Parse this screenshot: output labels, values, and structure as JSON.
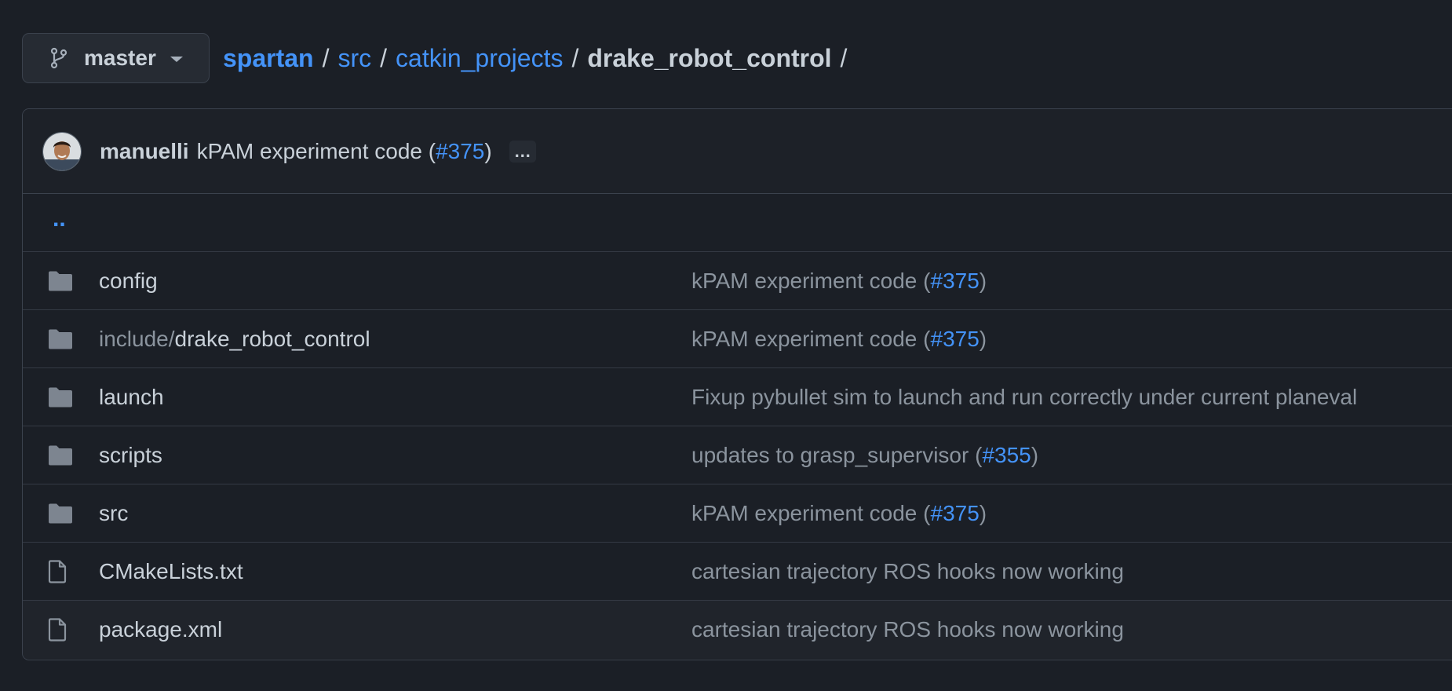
{
  "branch": {
    "name": "master",
    "icon": "git-branch-icon"
  },
  "breadcrumb": {
    "items": [
      "spartan",
      "src",
      "catkin_projects"
    ],
    "current": "drake_robot_control",
    "separator": "/"
  },
  "latest_commit": {
    "author": "manuelli",
    "message": "kPAM experiment code",
    "pr": "#375",
    "more": "…"
  },
  "parent_link": "..",
  "files": [
    {
      "type": "folder",
      "prefix": "",
      "name": "config",
      "message": "kPAM experiment code",
      "pr": "#375"
    },
    {
      "type": "folder",
      "prefix": "include/",
      "name": "drake_robot_control",
      "message": "kPAM experiment code",
      "pr": "#375"
    },
    {
      "type": "folder",
      "prefix": "",
      "name": "launch",
      "message": "Fixup pybullet sim to launch and run correctly under current planeval",
      "pr": ""
    },
    {
      "type": "folder",
      "prefix": "",
      "name": "scripts",
      "message": "updates to grasp_supervisor",
      "pr": "#355"
    },
    {
      "type": "folder",
      "prefix": "",
      "name": "src",
      "message": "kPAM experiment code",
      "pr": "#375"
    },
    {
      "type": "file",
      "prefix": "",
      "name": "CMakeLists.txt",
      "message": "cartesian trajectory ROS hooks now working",
      "pr": ""
    },
    {
      "type": "file",
      "prefix": "",
      "name": "package.xml",
      "message": "cartesian trajectory ROS hooks now working",
      "pr": ""
    }
  ],
  "colors": {
    "background": "#1b1f26",
    "link": "#4493f8",
    "text": "#c9d1d9",
    "muted": "#8b949e",
    "border": "#3b424d",
    "icon": "#8b949e"
  }
}
